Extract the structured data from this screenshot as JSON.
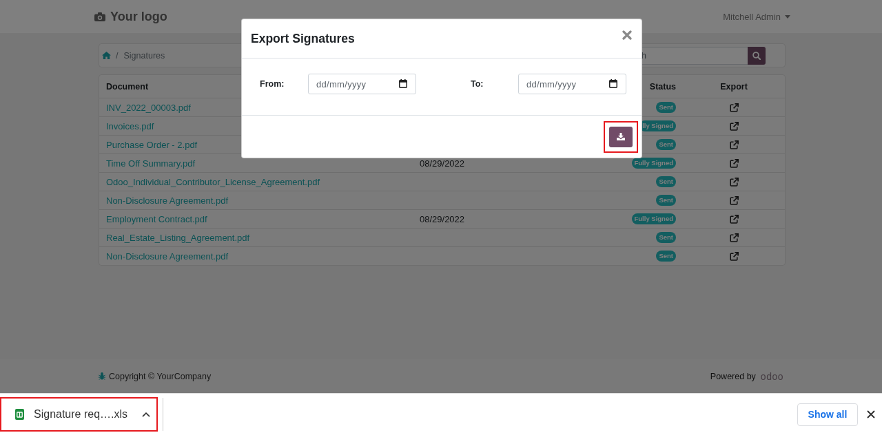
{
  "navbar": {
    "logo": "Your logo",
    "user_menu": "Mitchell Admin"
  },
  "breadcrumb": {
    "separator": "/",
    "current": "Signatures"
  },
  "search": {
    "placeholder": "h"
  },
  "table": {
    "columns": [
      {
        "kind": "document",
        "label": "Document"
      },
      {
        "kind": "status",
        "label": "Status"
      },
      {
        "kind": "export",
        "label": "Export"
      }
    ],
    "rows": [
      {
        "document": "INV_2022_00003.pdf",
        "status": "Sent"
      },
      {
        "document": "Invoices.pdf",
        "status": "lly Signed"
      },
      {
        "document": "Purchase Order - 2.pdf",
        "status": "Sent"
      },
      {
        "document": "Time Off Summary.pdf",
        "date": "08/29/2022",
        "status": "Fully Signed"
      },
      {
        "document": "Odoo_Individual_Contributor_License_Agreement.pdf",
        "status": "Sent"
      },
      {
        "document": "Non-Disclosure Agreement.pdf",
        "status": "Sent"
      },
      {
        "document": "Employment Contract.pdf",
        "date": "08/29/2022",
        "status": "Fully Signed"
      },
      {
        "document": "Real_Estate_Listing_Agreement.pdf",
        "status": "Sent"
      },
      {
        "document": "Non-Disclosure Agreement.pdf",
        "status": "Sent"
      }
    ]
  },
  "footer": {
    "copyright": "Copyright © YourCompany",
    "powered_by": "Powered by",
    "brand": "odoo"
  },
  "modal": {
    "title": "Export Signatures",
    "fields": [
      {
        "label": "From:",
        "placeholder": "dd/mm/yyyy"
      },
      {
        "label": "To:",
        "placeholder": "dd/mm/yyyy"
      }
    ],
    "download_button": {
      "highlighted": true
    }
  },
  "download_bar": {
    "items": [
      {
        "filename": "Signature req….xls",
        "highlighted": true
      }
    ],
    "show_all": "Show all"
  }
}
